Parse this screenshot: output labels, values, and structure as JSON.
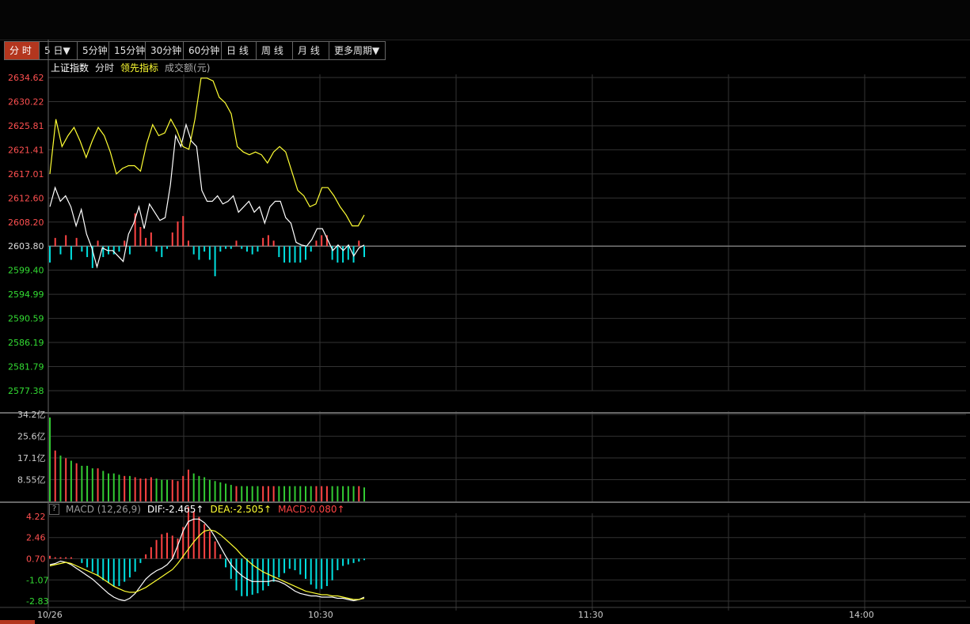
{
  "toolbar": {
    "buttons": [
      {
        "label": "分 时",
        "active": true
      },
      {
        "label": "5 日▼",
        "active": false
      },
      {
        "label": "5分钟",
        "active": false
      },
      {
        "label": "15分钟",
        "active": false
      },
      {
        "label": "30分钟",
        "active": false
      },
      {
        "label": "60分钟",
        "active": false
      },
      {
        "label": "日 线",
        "active": false
      },
      {
        "label": "周 线",
        "active": false
      },
      {
        "label": "月 线",
        "active": false
      },
      {
        "label": "更多周期▼",
        "active": false
      }
    ]
  },
  "legend": {
    "index_name": "上证指数",
    "intraday": "分时",
    "leading": "领先指标",
    "turnover": "成交额(元)"
  },
  "macd_legend": {
    "help": "?",
    "name": "MACD (12,26,9)",
    "dif": "DIF:-2.465↑",
    "dea": "DEA:-2.505↑",
    "macd": "MACD:0.080↑"
  },
  "colors": {
    "up": "#ff4444",
    "down": "#00e0e0",
    "vol_up": "#ff4444",
    "vol_down": "#33cc33",
    "price_line": "#ffffff",
    "lead_line": "#ffff33",
    "grid": "#333333",
    "axis_up": "#ff5050",
    "axis_down": "#33dd33"
  },
  "chart_data": [
    {
      "type": "line",
      "name": "price",
      "yticks": [
        "2634.62",
        "2630.22",
        "2625.81",
        "2621.41",
        "2617.01",
        "2612.60",
        "2608.20",
        "2603.80",
        "2599.40",
        "2594.99",
        "2590.59",
        "2586.19",
        "2581.79",
        "2577.38"
      ],
      "ylim": [
        2577.38,
        2634.62
      ],
      "base": 2603.8,
      "xticks": [
        "10/26",
        "10:30",
        "11:30",
        "14:00"
      ],
      "series": [
        {
          "values": [
            2611,
            2614.5,
            2612,
            2613,
            2611,
            2607.5,
            2610.5,
            2606,
            2603.5,
            2600,
            2603.5,
            2603,
            2603,
            2602,
            2601,
            2606,
            2608,
            2611,
            2607,
            2611.5,
            2610,
            2608.5,
            2609,
            2615,
            2624,
            2622,
            2626,
            2623,
            2622,
            2614,
            2612,
            2612,
            2613,
            2611.5,
            2612,
            2613,
            2610,
            2611,
            2612,
            2610,
            2611,
            2608,
            2611,
            2612,
            2612,
            2609,
            2608,
            2604.5,
            2604,
            2603.8,
            2605,
            2607,
            2607,
            2605,
            2603,
            2604,
            2603,
            2604,
            2602,
            2603.5,
            2604
          ]
        },
        {
          "values": [
            2617,
            2627,
            2622,
            2624,
            2625.5,
            2623,
            2620,
            2623,
            2625.5,
            2624,
            2621,
            2617,
            2618,
            2618.5,
            2618.5,
            2617.5,
            2622.5,
            2626,
            2624,
            2624.5,
            2627,
            2625,
            2622,
            2621.5,
            2627,
            2634.5,
            2634.5,
            2634,
            2631,
            2630,
            2628,
            2622,
            2621,
            2620.5,
            2621,
            2620.5,
            2619,
            2621,
            2622,
            2621,
            2617.5,
            2614,
            2613,
            2611,
            2611.5,
            2614.5,
            2614.5,
            2613,
            2611,
            2609.5,
            2607.5,
            2607.5,
            2609.5
          ]
        }
      ],
      "bars": [
        -3,
        1.5,
        -1.5,
        2,
        -2.5,
        1.5,
        -1,
        -2,
        -4,
        1,
        -2,
        -1.5,
        -1.5,
        -1,
        1,
        -1.5,
        6,
        3.5,
        1.5,
        2.5,
        -1,
        -2,
        -0.5,
        2.5,
        4.5,
        5.5,
        1,
        -1.5,
        -2.5,
        -1,
        -2.5,
        -5.5,
        -1,
        -0.5,
        -0.5,
        1,
        -0.5,
        -1,
        -1.5,
        -1,
        1.5,
        2,
        1,
        -2,
        -3,
        -3,
        -3,
        -3,
        -2.5,
        -1,
        1,
        2,
        2,
        -2.5,
        -3,
        -3,
        -2.5,
        -3,
        1,
        -2
      ]
    },
    {
      "type": "bar",
      "name": "turnover",
      "yticks": [
        "34.2亿",
        "25.6亿",
        "17.1亿",
        "8.55亿"
      ],
      "ylim": [
        0,
        34.2
      ],
      "values": [
        33,
        20,
        18,
        17,
        16,
        15,
        14,
        14,
        13,
        13,
        12,
        11,
        11,
        10.5,
        10,
        10,
        9.5,
        9,
        9,
        9.5,
        9,
        8.5,
        8.5,
        8.5,
        8,
        10,
        12.5,
        11,
        10,
        9.5,
        8.5,
        8,
        7.5,
        7,
        6.5,
        6,
        6,
        6,
        6,
        6,
        6,
        6,
        6,
        6,
        6,
        6,
        6,
        6,
        6,
        6,
        6,
        6,
        6,
        6,
        6,
        6,
        6,
        6,
        6,
        5.5
      ]
    },
    {
      "type": "bar",
      "name": "macd",
      "yticks": [
        "4.22",
        "2.46",
        "0.70",
        "-1.07",
        "-2.83"
      ],
      "ylim": [
        -2.83,
        4.22
      ],
      "macd_bars": [
        0.2,
        0.1,
        0.1,
        0.1,
        0.1,
        0,
        -0.3,
        -0.6,
        -0.9,
        -1.2,
        -1.5,
        -1.7,
        -1.9,
        -1.9,
        -1.6,
        -1.3,
        -0.9,
        -0.3,
        0.3,
        0.8,
        1.3,
        1.7,
        1.8,
        1.6,
        1.4,
        2.2,
        3.6,
        3.3,
        2.9,
        2.4,
        1.9,
        1.2,
        0.3,
        -0.6,
        -1.4,
        -2.2,
        -2.6,
        -2.6,
        -2.5,
        -2.4,
        -2.2,
        -1.9,
        -1.6,
        -1.3,
        -1.0,
        -0.7,
        -0.8,
        -1.1,
        -1.4,
        -1.8,
        -2.1,
        -2.1,
        -1.9,
        -1.5,
        -0.8,
        -0.5,
        -0.4,
        -0.3,
        -0.2,
        -0.1
      ],
      "dif": [
        0.2,
        0.3,
        0.5,
        0.4,
        0.2,
        -0.1,
        -0.4,
        -0.7,
        -1.0,
        -1.4,
        -1.8,
        -2.2,
        -2.5,
        -2.7,
        -2.8,
        -2.6,
        -2.2,
        -1.6,
        -1.0,
        -0.6,
        -0.3,
        -0.1,
        0.2,
        0.7,
        1.8,
        3.0,
        3.8,
        4.0,
        4.0,
        3.7,
        3.2,
        2.5,
        1.7,
        0.9,
        0.2,
        -0.3,
        -0.7,
        -1.0,
        -1.2,
        -1.2,
        -1.2,
        -1.2,
        -1.1,
        -1.2,
        -1.4,
        -1.7,
        -2.0,
        -2.2,
        -2.3,
        -2.4,
        -2.4,
        -2.5,
        -2.5,
        -2.5,
        -2.6,
        -2.6,
        -2.7,
        -2.8,
        -2.7,
        -2.5
      ],
      "dea": [
        0.1,
        0.2,
        0.3,
        0.4,
        0.3,
        0.1,
        -0.1,
        -0.3,
        -0.5,
        -0.7,
        -1.0,
        -1.3,
        -1.6,
        -1.8,
        -2.0,
        -2.1,
        -2.1,
        -1.9,
        -1.7,
        -1.4,
        -1.1,
        -0.8,
        -0.5,
        -0.2,
        0.3,
        0.9,
        1.5,
        2.1,
        2.6,
        3.0,
        3.1,
        3.0,
        2.7,
        2.3,
        1.9,
        1.5,
        1.0,
        0.6,
        0.2,
        -0.1,
        -0.4,
        -0.6,
        -0.8,
        -1.0,
        -1.2,
        -1.4,
        -1.6,
        -1.8,
        -2.0,
        -2.1,
        -2.2,
        -2.3,
        -2.3,
        -2.4,
        -2.4,
        -2.5,
        -2.6,
        -2.7,
        -2.7,
        -2.6
      ]
    }
  ]
}
